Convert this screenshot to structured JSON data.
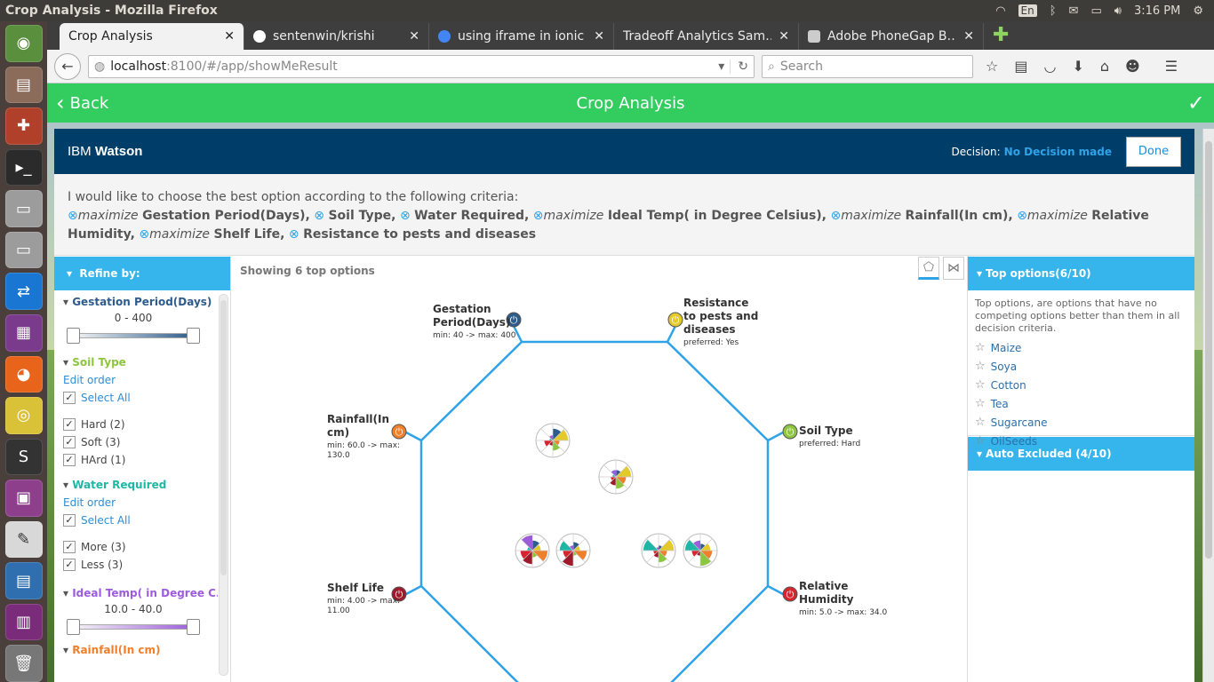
{
  "os": {
    "window_title": "Crop Analysis - Mozilla Firefox",
    "lang": "En",
    "clock": "3:16 PM"
  },
  "browser": {
    "tabs": [
      {
        "label": "Crop Analysis"
      },
      {
        "label": "sentenwin/krishi"
      },
      {
        "label": "using iframe in ionic …"
      },
      {
        "label": "Tradeoff Analytics Sam…"
      },
      {
        "label": "Adobe PhoneGap B…"
      }
    ],
    "url": {
      "host": "localhost",
      "rest": ":8100/#/app/showMeResult"
    },
    "search_placeholder": "Search"
  },
  "app": {
    "back_label": "Back",
    "title": "Crop Analysis"
  },
  "watson": {
    "brand": "IBM",
    "product": "Watson",
    "decision_label": "Decision:",
    "decision_value": "No Decision made",
    "done_label": "Done"
  },
  "criteria": {
    "intro": "I would like to choose the best option according to the following criteria:",
    "items": [
      {
        "prefix": "maximize",
        "name": "Gestation Period(Days),"
      },
      {
        "prefix": "",
        "name": "Soil Type,"
      },
      {
        "prefix": "",
        "name": "Water Required,"
      },
      {
        "prefix": "maximize",
        "name": "Ideal Temp( in Degree Celsius),"
      },
      {
        "prefix": "maximize",
        "name": "Rainfall(In cm),"
      },
      {
        "prefix": "maximize",
        "name": "Relative Humidity,"
      },
      {
        "prefix": "maximize",
        "name": "Shelf Life,"
      },
      {
        "prefix": "",
        "name": "Resistance to pests and diseases"
      }
    ]
  },
  "refine": {
    "header": "Refine by:",
    "gestation": {
      "label": "Gestation Period(Days)",
      "range": "0 - 400",
      "color": "#2d5c8c"
    },
    "soil": {
      "label": "Soil Type",
      "color": "#8cc63f",
      "edit": "Edit order",
      "select_all": "Select All",
      "options": [
        "Hard (2)",
        "Soft (3)",
        "HArd (1)"
      ]
    },
    "water": {
      "label": "Water Required",
      "color": "#1fb6a6",
      "edit": "Edit order",
      "select_all": "Select All",
      "options": [
        "More (3)",
        "Less (3)"
      ]
    },
    "temp": {
      "label": "Ideal Temp( in Degree C...",
      "range": "10.0 - 40.0",
      "color": "#9d5cdb"
    },
    "rain": {
      "label": "Rainfall(In cm)",
      "color": "#f07f2c"
    }
  },
  "center": {
    "showing": "Showing 6 top options",
    "axes": [
      {
        "key": "gest",
        "title1": "Gestation",
        "title2": "Period(Days)",
        "sub": "min: 40 -> max: 400",
        "color": "#2d5c8c"
      },
      {
        "key": "resist",
        "title1": "Resistance",
        "title2": "to pests and",
        "title3": "diseases",
        "sub": "preferred: Yes",
        "color": "#e3c92a"
      },
      {
        "key": "rain",
        "title1": "Rainfall(In",
        "title2": "cm)",
        "sub": "min: 60.0 -> max:",
        "sub2": "130.0",
        "color": "#f07f2c"
      },
      {
        "key": "soil",
        "title1": "Soil Type",
        "sub": "preferred: Hard",
        "color": "#8cc63f"
      },
      {
        "key": "shelf",
        "title1": "Shelf Life",
        "sub": "min: 4.00 -> max:",
        "sub2": "11.00",
        "color": "#a0192a"
      },
      {
        "key": "humid",
        "title1": "Relative",
        "title2": "Humidity",
        "sub": "min: 5.0 -> max: 34.0",
        "color": "#d9232d"
      }
    ]
  },
  "top_options": {
    "header": "Top options(6/10)",
    "desc": "Top options, are options that have no competing options better than them in all decision criteria.",
    "items": [
      "Maize",
      "Soya",
      "Cotton",
      "Tea",
      "Sugarcane",
      "OilSeeds"
    ]
  },
  "auto_excluded": {
    "header": "Auto Excluded (4/10)"
  },
  "colors": {
    "accent": "#35b5eb",
    "header_green": "#33cd5f",
    "watson_blue": "#003e6a",
    "link": "#2b8ed6"
  }
}
